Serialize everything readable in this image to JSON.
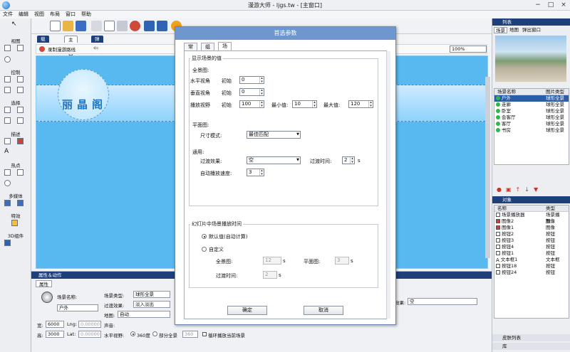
{
  "app": {
    "title": "漫游大师 - ljgs.tw - [主窗口]",
    "window_buttons": [
      "−",
      "□",
      "×"
    ]
  },
  "menu": [
    "文件",
    "编辑",
    "视图",
    "布局",
    "窗口",
    "帮助"
  ],
  "left_tools": {
    "sections": [
      "视图",
      "控制",
      "选择",
      "描述",
      "热点",
      "多媒体",
      "特效",
      "3D组件"
    ]
  },
  "center": {
    "tabs": [
      "载入窗口",
      "主窗口",
      "弹出窗口"
    ],
    "active_tab": 1,
    "record_path_label": "录制漫游路线",
    "zoom_value": "100%",
    "logo_text": "丽晶阁"
  },
  "properties": {
    "header": "属性＆动作",
    "tab": "属性",
    "scene_name_label": "场景名称:",
    "scene_name_value": "户外",
    "scene_type_label": "场景类型:",
    "scene_type_value": "球形全景",
    "transition_label": "过渡效果:",
    "transition_value": "淡入淡出",
    "map_label": "地图:",
    "map_value": "自动",
    "width_label": "宽:",
    "width_value": "6000",
    "height_label": "高:",
    "height_value": "3000",
    "lng_label": "Lng:",
    "lng_value": "0.00000",
    "lat_label": "Lat:",
    "lat_value": "0.00000",
    "sound_label": "声音:",
    "hfov_label": "水平视野:",
    "radio_360": "360度",
    "radio_partial": "部分全景",
    "partial_value": "360",
    "loop_label": "循环播放当前场景",
    "effect_label": "效果:",
    "effect_value": "空"
  },
  "right": {
    "list_header": "列表",
    "tabs": [
      "场景",
      "地图",
      "弹出窗口"
    ],
    "scene_cols": [
      "场景名称",
      "图片类型"
    ],
    "scenes": [
      {
        "name": "户外",
        "type": "球形全景"
      },
      {
        "name": "走廊",
        "type": "球形全景"
      },
      {
        "name": "卧室",
        "type": "球形全景"
      },
      {
        "name": "会客厅",
        "type": "球形全景"
      },
      {
        "name": "客厅",
        "type": "球形全景"
      },
      {
        "name": "书房",
        "type": "球形全景"
      }
    ],
    "object_header": "对象",
    "object_cols": [
      "名称",
      "类型"
    ],
    "objects": [
      {
        "name": "场景播放器",
        "type": "场景播放..."
      },
      {
        "name": "图像2",
        "type": "图像"
      },
      {
        "name": "图像1",
        "type": "图像"
      },
      {
        "name": "按钮2",
        "type": "按钮"
      },
      {
        "name": "按钮3",
        "type": "按钮"
      },
      {
        "name": "按钮4",
        "type": "按钮"
      },
      {
        "name": "按钮1",
        "type": "按钮"
      },
      {
        "name": "文本框1",
        "type": "文本框"
      },
      {
        "name": "按钮18",
        "type": "按钮"
      },
      {
        "name": "按钮24",
        "type": "按钮"
      }
    ],
    "skin_list": "皮肤列表",
    "library": "库"
  },
  "dialog": {
    "title": "首选参数",
    "tabs": [
      "常规",
      "组件",
      "场景"
    ],
    "active_tab": 2,
    "group_display": "显示场景的值",
    "panorama_label": "全景图:",
    "pan_label": "水平视角",
    "tilt_label": "垂直视角",
    "fov_label": "播放视野",
    "init_label": "初始",
    "pan_init": "0",
    "tilt_init": "0",
    "fov_init": "100",
    "min_label": "最小值:",
    "min_value": "10",
    "max_label": "最大值:",
    "max_value": "120",
    "plane_label": "平面图:",
    "size_mode_label": "尺寸模式:",
    "size_mode_value": "最佳匹配",
    "general_label": "通用:",
    "transition_label": "过渡效果:",
    "transition_value": "空",
    "transition_time_label": "过渡时间:",
    "transition_time_value": "2",
    "seconds": "s",
    "autorotate_label": "自动播放速度:",
    "autorotate_value": "3",
    "group_slideshow": "幻灯片中场景播放时间",
    "radio_default": "默认值(自动计算)",
    "radio_custom": "自定义",
    "custom_pano_label": "全景图:",
    "custom_pano_value": "12",
    "custom_plane_label": "平面图:",
    "custom_plane_value": "3",
    "custom_trans_label": "过渡时间:",
    "custom_trans_value": "2",
    "ok": "确定",
    "cancel": "取消"
  }
}
